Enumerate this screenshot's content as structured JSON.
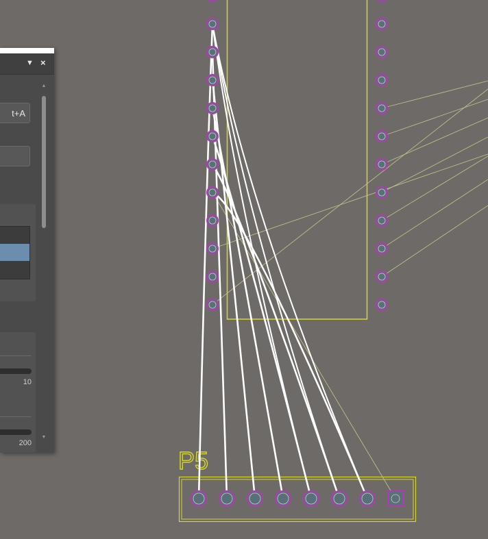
{
  "canvas": {
    "background": "#6e6a67",
    "component_outline_color": "#d7d72a",
    "pad_ring_color": "#b23ab6",
    "pad_fill_color": "#5a7078",
    "ratsnest_color": "#c8c88a",
    "routed_track_color": "#ffffff",
    "designator": "P5"
  },
  "panel": {
    "button_shortcut_label": "t+A",
    "slider_1_value": "10",
    "slider_2_value": "200",
    "menu_icon": "▼",
    "close_icon": "×",
    "scroll_up_icon": "▲",
    "scroll_down_icon": "▼"
  }
}
